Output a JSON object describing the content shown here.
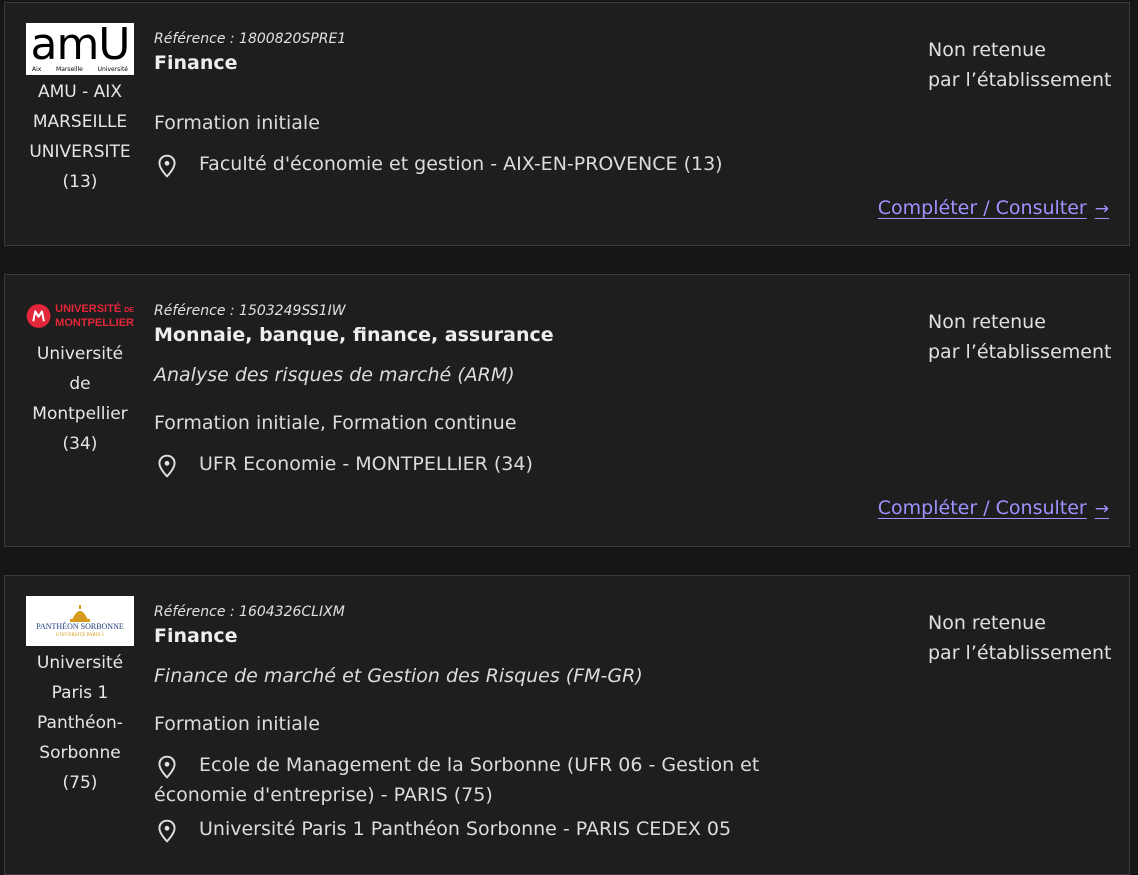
{
  "cards": [
    {
      "logo": {
        "main_text": "amU",
        "small_1": "Aix",
        "small_2": "Marseille",
        "small_3": "Université"
      },
      "institution": "AMU - AIX MARSEILLE UNIVERSITE (13)",
      "reference": "Référence : 1800820SPRE1",
      "title": "Finance",
      "subtitle": "",
      "formation": "Formation initiale",
      "location": "Faculté d'économie et gestion - AIX-EN-PROVENCE (13)",
      "status_1": "Non retenue",
      "status_2": "par l’établissement",
      "action": "Compléter / Consulter"
    },
    {
      "logo": {
        "line_1": "UNIVERSITÉ",
        "line_1b": "DE",
        "line_2": "MONTPELLIER"
      },
      "institution": "Université de Montpellier (34)",
      "reference": "Référence : 1503249SS1IW",
      "title": "Monnaie, banque, finance, assurance",
      "subtitle": "Analyse des risques de marché (ARM)",
      "formation": "Formation initiale, Formation continue",
      "location": "UFR Economie - MONTPELLIER (34)",
      "status_1": "Non retenue",
      "status_2": "par l’établissement",
      "action": "Compléter / Consulter"
    },
    {
      "logo": {
        "line_1": "PANTHÉON SORBONNE",
        "line_2": "UNIVERSITÉ PARIS 1"
      },
      "institution": "Université Paris 1 Panthéon-Sorbonne (75)",
      "reference": "Référence : 1604326CLIXM",
      "title": "Finance",
      "subtitle": "Finance de marché et Gestion des Risques (FM-GR)",
      "formation": "Formation initiale",
      "location": "Ecole de Management de la Sorbonne (UFR 06 - Gestion et économie d'entreprise) - PARIS (75)",
      "location_2": "Université Paris 1 Panthéon Sorbonne - PARIS CEDEX 05",
      "status_1": "Non retenue",
      "status_2": "par l’établissement"
    }
  ],
  "colors": {
    "accent_link": "#9e93ff",
    "montpellier_red": "#e3263a",
    "sorbonne_blue": "#1d3a7a",
    "sorbonne_gold": "#d89a1a"
  }
}
